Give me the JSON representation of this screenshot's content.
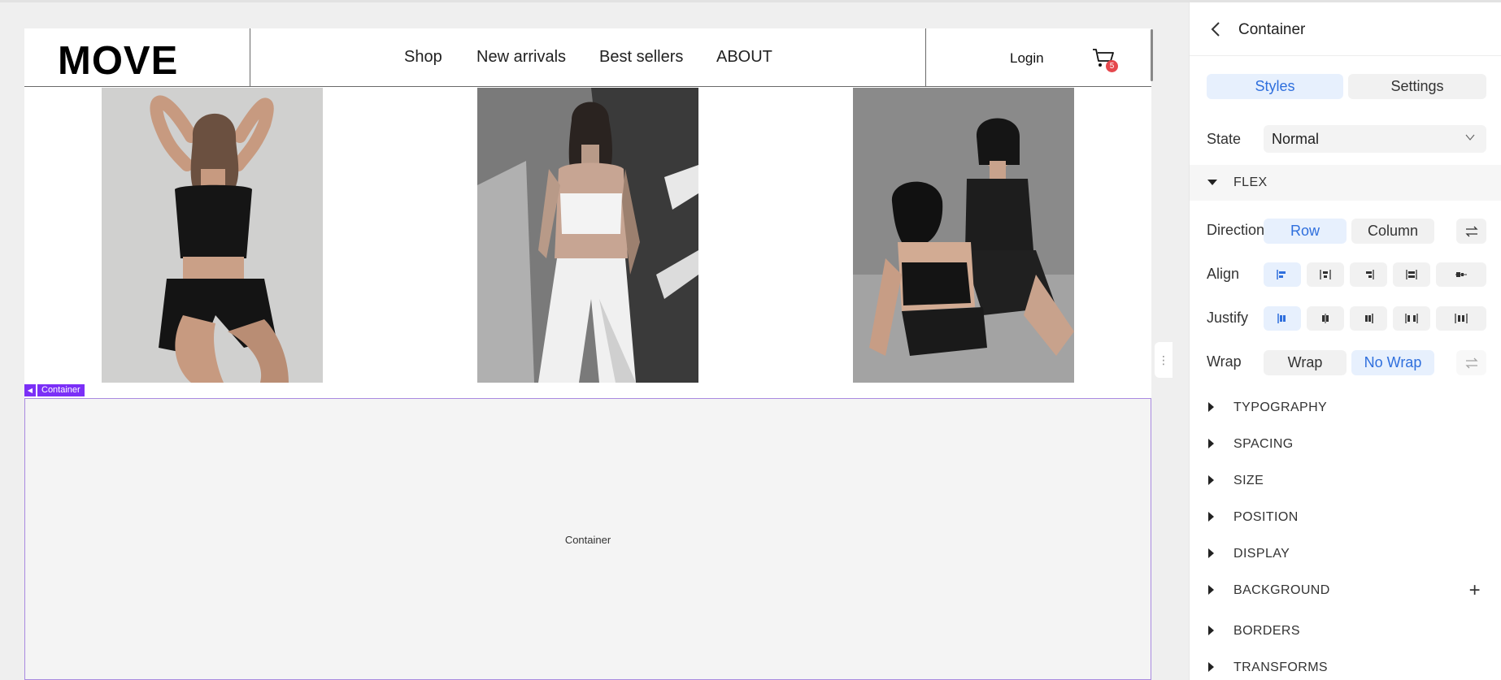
{
  "site": {
    "logo": "MOVE",
    "nav": [
      "Shop",
      "New arrivals",
      "Best sellers",
      "ABOUT"
    ],
    "login": "Login",
    "cart_count": "5"
  },
  "canvas": {
    "container_tag": "Container",
    "container_placeholder": "Container"
  },
  "panel": {
    "title": "Container",
    "tabs": {
      "styles": "Styles",
      "settings": "Settings",
      "active": "Styles"
    },
    "state": {
      "label": "State",
      "value": "Normal"
    },
    "flex": {
      "section": "FLEX",
      "direction": {
        "label": "Direction",
        "row": "Row",
        "column": "Column",
        "active": "Row"
      },
      "align": {
        "label": "Align",
        "active_index": 0
      },
      "justify": {
        "label": "Justify",
        "active_index": 0
      },
      "wrap": {
        "label": "Wrap",
        "wrap": "Wrap",
        "nowrap": "No Wrap",
        "active": "No Wrap"
      }
    },
    "sections": [
      "TYPOGRAPHY",
      "SPACING",
      "SIZE",
      "POSITION",
      "DISPLAY",
      "BACKGROUND",
      "BORDERS",
      "TRANSFORMS"
    ]
  },
  "colors": {
    "accent": "#2f6fdd",
    "accent_bg": "#e7f0fd",
    "selection": "#7b2ff7",
    "badge": "#e5484d"
  },
  "icons": [
    "chevron-left-icon",
    "cart-icon",
    "chevron-down-icon",
    "swap-icon",
    "plus-icon",
    "vertical-dots-icon"
  ]
}
